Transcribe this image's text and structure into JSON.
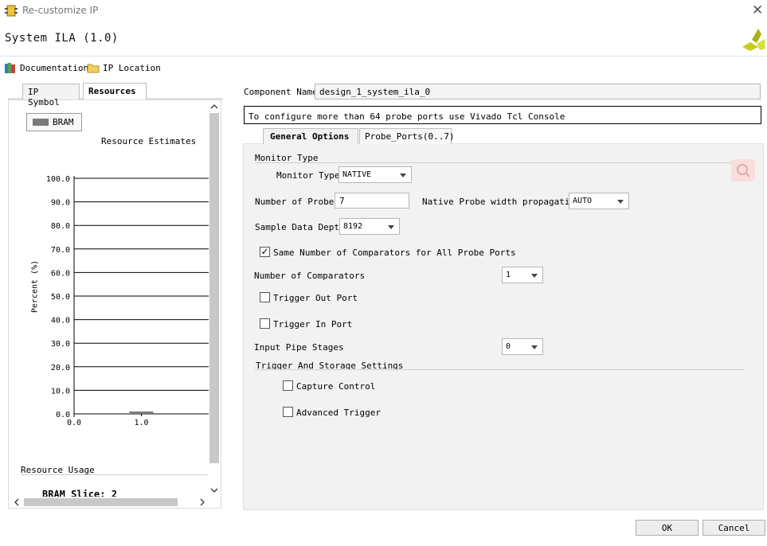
{
  "window": {
    "title": "Re-customize IP"
  },
  "header": {
    "ip_title": "System ILA (1.0)"
  },
  "toolbar": {
    "documentation": "Documentation",
    "ip_location": "IP Location"
  },
  "left_tabs": [
    "IP Symbol",
    "Resources"
  ],
  "chart_data": {
    "type": "bar",
    "title": "Resource Estimates",
    "legend": [
      "BRAM"
    ],
    "ylabel": "Percent (%)",
    "x_ticks": [
      "0.0",
      "1.0"
    ],
    "y_ticks": [
      "100.0",
      "90.0",
      "80.0",
      "70.0",
      "60.0",
      "50.0",
      "40.0",
      "30.0",
      "20.0",
      "10.0",
      "0.0"
    ],
    "ylim": [
      0,
      100
    ],
    "xlim": [
      0,
      2
    ],
    "series": [
      {
        "name": "BRAM",
        "x": [
          1.0
        ],
        "values": [
          1.0
        ]
      }
    ],
    "bar_color": "#7a7a7a",
    "grid": true
  },
  "resource_usage": {
    "title": "Resource Usage",
    "item": "BRAM Slice: 2"
  },
  "component": {
    "label": "Component Name",
    "value": "design_1_system_ila_0"
  },
  "notice": "To configure more than 64 probe ports use Vivado Tcl Console",
  "right_tabs": [
    "General Options",
    "Probe_Ports(0..7)"
  ],
  "general": {
    "monitor_type_section": "Monitor Type",
    "monitor_type_label": "Monitor Type",
    "monitor_type_value": "NATIVE",
    "num_probes_label": "Number of Probes",
    "num_probes_value": "7",
    "width_prop_label": "Native Probe width propagation",
    "width_prop_value": "AUTO",
    "sample_depth_label": "Sample Data Depth",
    "sample_depth_value": "8192",
    "same_comparators_label": "Same Number of Comparators for All Probe Ports",
    "same_comparators_checked": true,
    "num_comparators_label": "Number of Comparators",
    "num_comparators_value": "1",
    "trigger_out_label": "Trigger Out Port",
    "trigger_in_label": "Trigger In Port",
    "input_pipe_label": "Input Pipe Stages",
    "input_pipe_value": "0",
    "trigger_storage_section": "Trigger And Storage Settings",
    "capture_control_label": "Capture Control",
    "advanced_trigger_label": "Advanced Trigger"
  },
  "buttons": {
    "ok": "OK",
    "cancel": "Cancel"
  },
  "icons": [
    "app-icon",
    "close-icon",
    "xilinx-logo-icon",
    "documentation-icon",
    "folder-icon",
    "search-icon",
    "scroll-up-icon",
    "scroll-down-icon",
    "scroll-left-icon",
    "scroll-right-icon"
  ],
  "colors": {
    "logo": "#c5cf1a",
    "bar": "#7a7a7a",
    "search_bg": "#f9dede"
  }
}
